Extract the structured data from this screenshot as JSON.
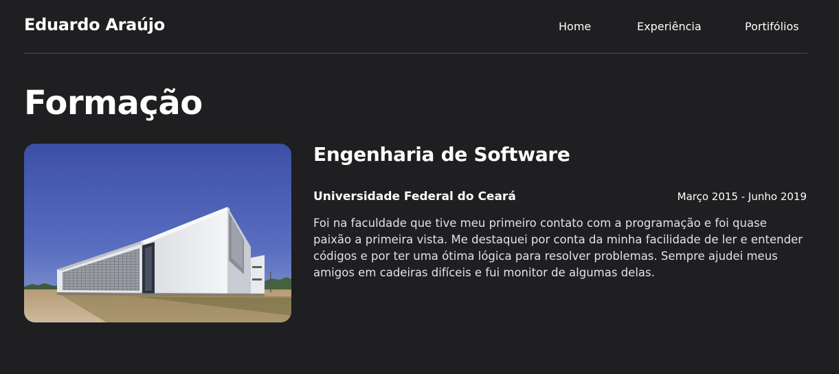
{
  "header": {
    "brand": "Eduardo Araújo",
    "nav": {
      "home": "Home",
      "experience": "Experiência",
      "portfolios": "Portifólios"
    }
  },
  "education": {
    "section_title": "Formação",
    "course": "Engenharia de Software",
    "institution": "Universidade Federal do Ceará",
    "period": "Março 2015 - Junho 2019",
    "description": "Foi na faculdade que tive meu primeiro contato com a programação e foi quase paixão a primeira vista. Me destaquei por conta da minha facilidade de ler e entender códigos e por ter uma ótima lógica para resolver problemas. Sempre ajudei meus amigos em cadeiras difíceis e fui monitor de algumas delas."
  },
  "colors": {
    "background": "#1f1e20",
    "text": "#ffffff",
    "divider": "#4a494c"
  }
}
